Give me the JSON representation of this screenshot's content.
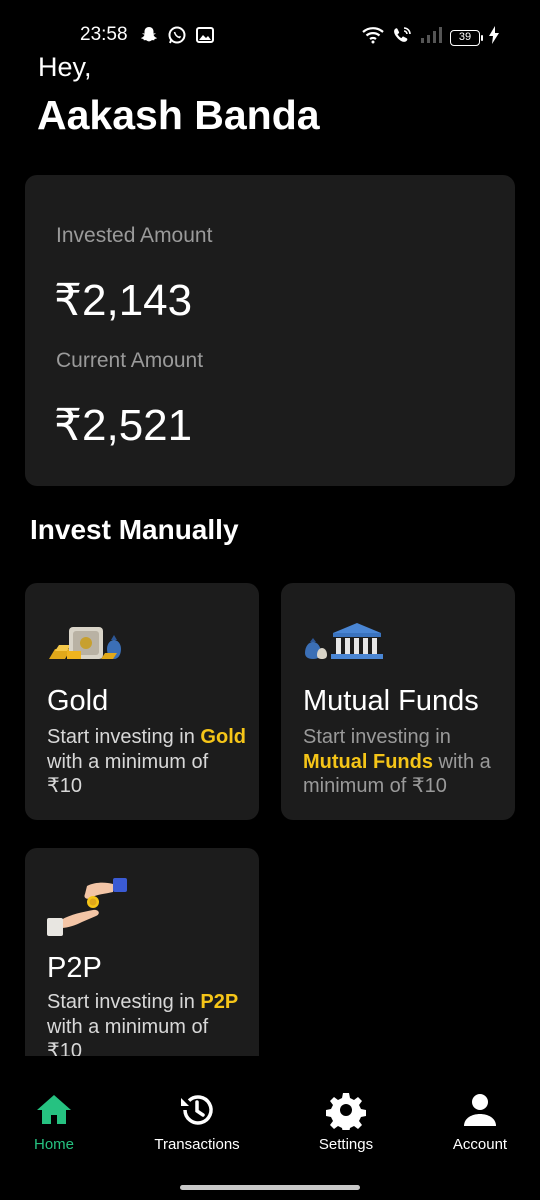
{
  "status_bar": {
    "time": "23:58",
    "battery": "39",
    "left_icons": [
      "snapchat-icon",
      "whatsapp-icon",
      "gallery-icon"
    ],
    "right_icons": [
      "wifi-icon",
      "wifi-call-icon",
      "signal-icon",
      "battery-icon",
      "charging-icon"
    ]
  },
  "greeting": {
    "hello": "Hey,",
    "name": "Aakash Banda"
  },
  "summary": {
    "invested_label": "Invested Amount",
    "invested_value": "₹2,143",
    "current_label": "Current Amount",
    "current_value": "₹2,521"
  },
  "invest_section": {
    "title": "Invest Manually",
    "cards": [
      {
        "icon": "gold-vault-icon",
        "title": "Gold",
        "desc_prefix": "Start investing in ",
        "highlight": "Gold",
        "desc_suffix": " with a minimum of ₹10"
      },
      {
        "icon": "bank-moneybag-icon",
        "title": "Mutual Funds",
        "desc_prefix": "Start investing in ",
        "highlight": "Mutual Funds",
        "desc_suffix": " with a minimum of ₹10"
      },
      {
        "icon": "hand-coin-icon",
        "title": "P2P",
        "desc_prefix": "Start investing in ",
        "highlight": "P2P",
        "desc_suffix": " with a minimum of ₹10"
      }
    ]
  },
  "bottom_nav": {
    "active": "Home",
    "accent": "#26c281",
    "items": [
      {
        "label": "Home",
        "icon": "home-icon"
      },
      {
        "label": "Transactions",
        "icon": "history-icon"
      },
      {
        "label": "Settings",
        "icon": "gear-icon"
      },
      {
        "label": "Account",
        "icon": "person-icon"
      }
    ]
  },
  "colors": {
    "background": "#000000",
    "card": "#1c1c1c",
    "highlight": "#f5c518",
    "accent": "#26c281"
  }
}
